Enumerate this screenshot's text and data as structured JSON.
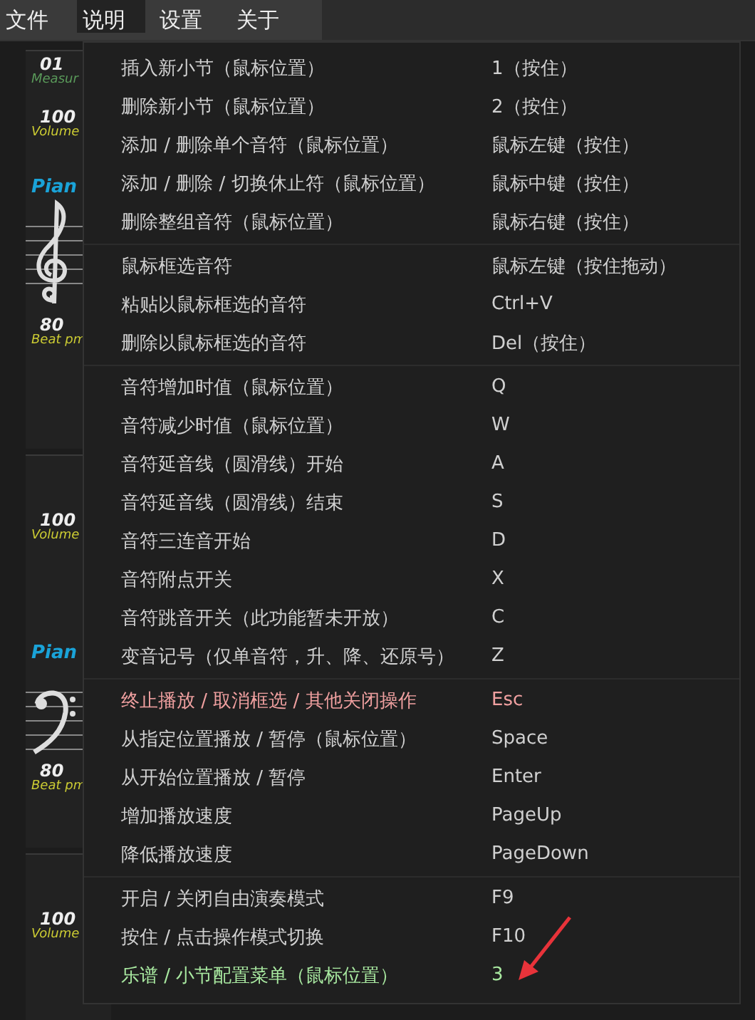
{
  "menubar": [
    {
      "label": "文件",
      "selected": false
    },
    {
      "label": "说明",
      "selected": true
    },
    {
      "label": "设置",
      "selected": false
    },
    {
      "label": "关于",
      "selected": false
    }
  ],
  "tracks": [
    {
      "measure": "01",
      "measure_label": "Measur",
      "volume": "100",
      "volume_label": "Volume",
      "instrument": "Pian",
      "clef": {
        "kind": "treble"
      },
      "tempo": "80",
      "tempo_label": "Beat pm"
    },
    {
      "volume": "100",
      "volume_label": "Volume",
      "instrument": "Pian",
      "clef": {
        "kind": "bass"
      },
      "tempo": "80",
      "tempo_label": "Beat pm"
    },
    {
      "volume": "100",
      "volume_label": "Volume"
    }
  ],
  "dropdown": {
    "groups": [
      [
        {
          "label": "插入新小节（鼠标位置）",
          "shortcut": "1（按住）",
          "kind": "normal"
        },
        {
          "label": "删除新小节（鼠标位置）",
          "shortcut": "2（按住）",
          "kind": "normal"
        },
        {
          "label": "添加 / 删除单个音符（鼠标位置）",
          "shortcut": "鼠标左键（按住）",
          "kind": "normal"
        },
        {
          "label": "添加 / 删除 / 切换休止符（鼠标位置）",
          "shortcut": "鼠标中键（按住）",
          "kind": "normal"
        },
        {
          "label": "删除整组音符（鼠标位置）",
          "shortcut": "鼠标右键（按住）",
          "kind": "normal"
        }
      ],
      [
        {
          "label": "鼠标框选音符",
          "shortcut": "鼠标左键（按住拖动）",
          "kind": "normal"
        },
        {
          "label": "粘贴以鼠标框选的音符",
          "shortcut": "Ctrl+V",
          "kind": "normal"
        },
        {
          "label": "删除以鼠标框选的音符",
          "shortcut": "Del（按住）",
          "kind": "normal"
        }
      ],
      [
        {
          "label": "音符增加时值（鼠标位置）",
          "shortcut": "Q",
          "kind": "normal"
        },
        {
          "label": "音符减少时值（鼠标位置）",
          "shortcut": "W",
          "kind": "normal"
        },
        {
          "label": "音符延音线（圆滑线）开始",
          "shortcut": "A",
          "kind": "normal"
        },
        {
          "label": "音符延音线（圆滑线）结束",
          "shortcut": "S",
          "kind": "normal"
        },
        {
          "label": "音符三连音开始",
          "shortcut": "D",
          "kind": "normal"
        },
        {
          "label": "音符附点开关",
          "shortcut": "X",
          "kind": "normal"
        },
        {
          "label": "音符跳音开关（此功能暂未开放）",
          "shortcut": "C",
          "kind": "normal"
        },
        {
          "label": "变音记号（仅单音符，升、降、还原号）",
          "shortcut": "Z",
          "kind": "normal"
        }
      ],
      [
        {
          "label": "终止播放 / 取消框选 / 其他关闭操作",
          "shortcut": "Esc",
          "kind": "stop"
        },
        {
          "label": "从指定位置播放 / 暂停（鼠标位置）",
          "shortcut": "Space",
          "kind": "normal"
        },
        {
          "label": "从开始位置播放 / 暂停",
          "shortcut": "Enter",
          "kind": "normal"
        },
        {
          "label": "增加播放速度",
          "shortcut": "PageUp",
          "kind": "normal"
        },
        {
          "label": "降低播放速度",
          "shortcut": "PageDown",
          "kind": "normal"
        }
      ],
      [
        {
          "label": "开启 / 关闭自由演奏模式",
          "shortcut": "F9",
          "kind": "normal"
        },
        {
          "label": "按住 / 点击操作模式切换",
          "shortcut": "F10",
          "kind": "normal"
        },
        {
          "label": "乐谱 / 小节配置菜单（鼠标位置）",
          "shortcut": "3",
          "kind": "config"
        }
      ]
    ]
  }
}
